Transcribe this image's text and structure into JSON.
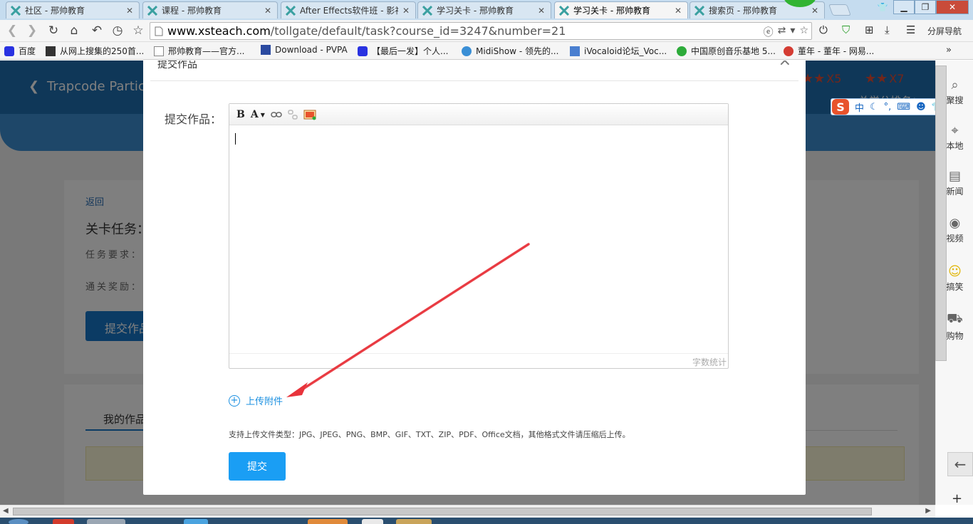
{
  "browser": {
    "tabs": [
      {
        "label": "社区 - 邢帅教育",
        "active": false
      },
      {
        "label": "课程 - 邢帅教育",
        "active": false
      },
      {
        "label": "After Effects软件班 - 影视",
        "active": false
      },
      {
        "label": "学习关卡 - 邢帅教育",
        "active": false
      },
      {
        "label": "学习关卡 - 邢帅教育",
        "active": true
      },
      {
        "label": "搜索页 - 邢帅教育",
        "active": false
      }
    ],
    "url_host": "www.xsteach.com",
    "url_path": "/tollgate/default/task?course_id=3247&number=21",
    "split_nav_label": "分屏导航",
    "bookmarks": [
      {
        "label": "百度"
      },
      {
        "label": "从网上搜集的250首..."
      },
      {
        "label": "邢帅教育——官方..."
      },
      {
        "label": "Download - PVPA"
      },
      {
        "label": "【最后一发】个人..."
      },
      {
        "label": "MidiShow - 领先的..."
      },
      {
        "label": "iVocaloid论坛_Voc..."
      },
      {
        "label": "中国原创音乐基地 5..."
      },
      {
        "label": "董年 - 董年 - 网易..."
      }
    ],
    "bookmarks_more": "»"
  },
  "page": {
    "course_title": "Trapcode Partic",
    "stars_a": "X5",
    "stars_b": "X7",
    "rank_label": "总学分排名：",
    "back_link": "返回",
    "task_title": "关卡任务：",
    "task_requirement": "任务要求：",
    "reward": "通关奖励：",
    "submit_work_button": "提交作品",
    "my_works_tab": "我的作品"
  },
  "modal": {
    "title": "提交作品",
    "close": "×",
    "form_label": "提交作品：",
    "toolbar": {
      "bold": "B",
      "font_color": "A"
    },
    "word_count": "字数统计",
    "upload_label": "上传附件",
    "file_types_note": "支持上传文件类型：JPG、JPEG、PNG、BMP、GIF、TXT、ZIP、PDF、Office文档，其他格式文件请压缩后上传。",
    "submit_label": "提交"
  },
  "ime": {
    "mode": "中"
  },
  "sidebar": {
    "items": [
      {
        "label": "聚搜",
        "icon": "search-icon"
      },
      {
        "label": "本地",
        "icon": "location-icon"
      },
      {
        "label": "新闻",
        "icon": "news-icon"
      },
      {
        "label": "视频",
        "icon": "video-icon"
      },
      {
        "label": "搞笑",
        "icon": "laugh-icon"
      },
      {
        "label": "购物",
        "icon": "cart-icon"
      }
    ]
  },
  "colors": {
    "accent": "#1a9ef4",
    "header_blue": "#1f6fb1",
    "arrow_red": "#e8333b"
  }
}
